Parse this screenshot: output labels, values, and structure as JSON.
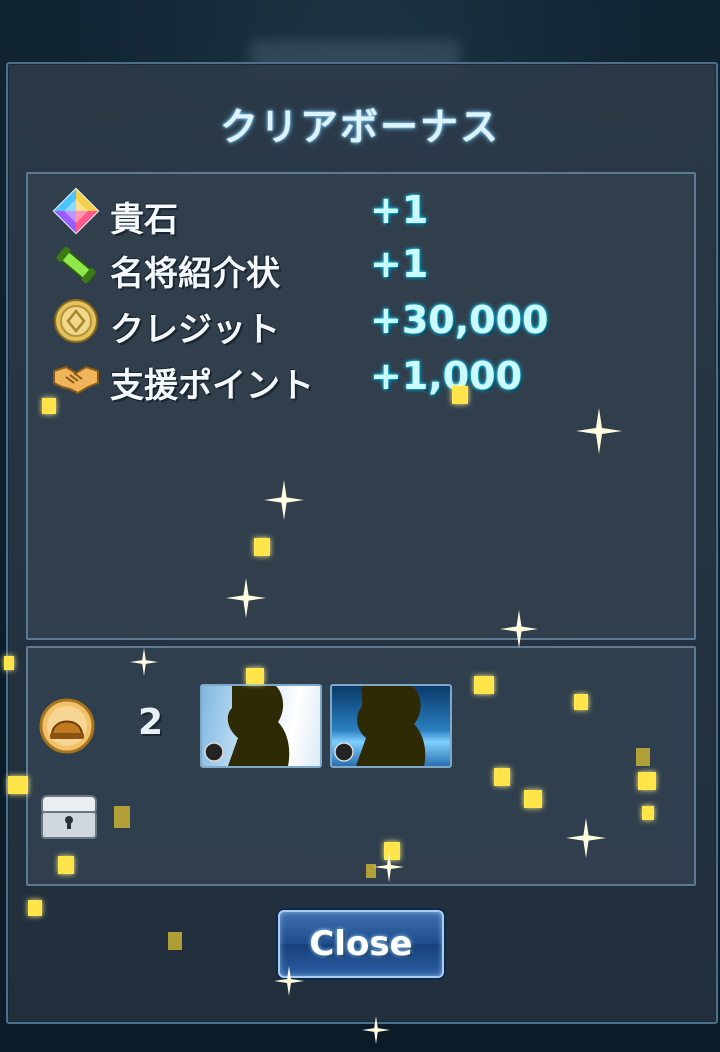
{
  "title": "クリアボーナス",
  "bonuses": [
    {
      "icon": "gem-icon",
      "label": "貴石",
      "value": "+1"
    },
    {
      "icon": "scroll-icon",
      "label": "名将紹介状",
      "value": "+1"
    },
    {
      "icon": "credit-coin-icon",
      "label": "クレジット",
      "value": "+30,000"
    },
    {
      "icon": "handshake-icon",
      "label": "支援ポイント",
      "value": "+1,000"
    }
  ],
  "rewards": {
    "helmet_count": "2"
  },
  "close_button": "Close",
  "colors": {
    "title_glow": "#6ec7ff",
    "value_cyan": "#18d8ff",
    "panel_border": "#5c7a92",
    "sparkle": "#ffe44a"
  }
}
